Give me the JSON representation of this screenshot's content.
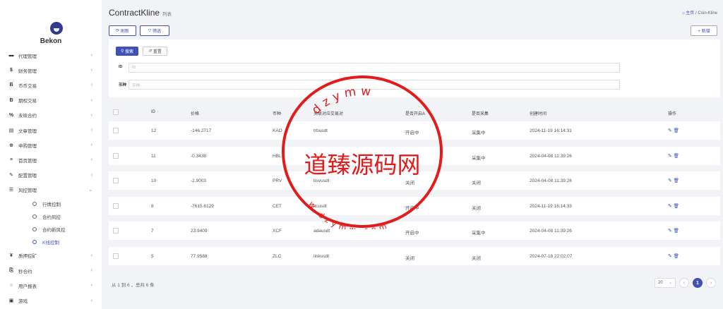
{
  "brand": {
    "name": "Bekon"
  },
  "sidebar": {
    "items": [
      {
        "icon": "agent-icon",
        "glyph": "▬",
        "label": "代理管理"
      },
      {
        "icon": "dollar-icon",
        "glyph": "$",
        "label": "财务管理"
      },
      {
        "icon": "bitcoin-icon",
        "glyph": "B",
        "label": "币币交易"
      },
      {
        "icon": "bitcoin-icon",
        "glyph": "B",
        "label": "期权交易"
      },
      {
        "icon": "link-icon",
        "glyph": "%",
        "label": "永续合约"
      },
      {
        "icon": "document-icon",
        "glyph": "▤",
        "label": "文章管理"
      },
      {
        "icon": "globe-icon",
        "glyph": "⊕",
        "label": "申购管理"
      },
      {
        "icon": "list-icon",
        "glyph": "≡",
        "label": "首页管理"
      },
      {
        "icon": "wrench-icon",
        "glyph": "✎",
        "label": "配置管理"
      },
      {
        "icon": "risk-icon",
        "glyph": "☰",
        "label": "风控管理"
      }
    ],
    "sub_items": [
      {
        "label": "行情控制"
      },
      {
        "label": "合约风控"
      },
      {
        "label": "合约新风控"
      },
      {
        "label": "K线控制"
      }
    ],
    "bottom_items": [
      {
        "icon": "yen-icon",
        "glyph": "¥",
        "label": "质押挖矿"
      },
      {
        "icon": "copy-icon",
        "glyph": "⎘",
        "label": "秒合约"
      },
      {
        "icon": "report-icon",
        "glyph": "○",
        "label": "用户报表"
      },
      {
        "icon": "game-icon",
        "glyph": "▣",
        "label": "游戏"
      }
    ]
  },
  "header": {
    "title": "ContractKline",
    "subtitle": "列表",
    "crumb_home": "主页",
    "crumb_sep": "/",
    "crumb_current": "Coin-Kline"
  },
  "toolbar": {
    "refresh": "刷新",
    "filter": "筛选",
    "add": "+ 新增"
  },
  "search": {
    "search_btn": "搜索",
    "reset_btn": "重置",
    "id_label": "ID",
    "id_placeholder": "ID",
    "coin_label": "币种",
    "coin_placeholder": "币种"
  },
  "table": {
    "headers": [
      "ID",
      "价格",
      "币种",
      "关联对应交易对",
      "是否开启A",
      "是否采集",
      "创建时间",
      "操作"
    ],
    "id_sort": "↑",
    "rows": [
      {
        "id": "12",
        "price": "-146.2717",
        "coin": "KAO",
        "pair": "trbusdt",
        "open": "开启中",
        "collect": "采集中",
        "time": "2024-11-19 16:14:31"
      },
      {
        "id": "11",
        "price": "-0.3438",
        "coin": "HBL",
        "pair": "",
        "open": "",
        "collect": "采集中",
        "time": "2024-04-08 11:39:26"
      },
      {
        "id": "10",
        "price": "-2.9003",
        "coin": "PRV",
        "pair": "bsvusdt",
        "open": "关闭",
        "collect": "关闭",
        "time": "2024-04-08 11:39:26"
      },
      {
        "id": "8",
        "price": "-7615.6129",
        "coin": "CET",
        "pair": "ltcusdt",
        "open": "开启中",
        "collect": "关闭",
        "time": "2024-11-19 16:14:33"
      },
      {
        "id": "7",
        "price": "23.9409",
        "coin": "XCF",
        "pair": "adausdt",
        "open": "开启中",
        "collect": "采集中",
        "time": "2024-04-08 11:39:26"
      },
      {
        "id": "5",
        "price": "77.9588",
        "coin": "ZLC",
        "pair": "linkusdt",
        "open": "关闭",
        "collect": "关闭",
        "time": "2024-07-18 22:02:07"
      }
    ]
  },
  "footer": {
    "summary": "从 1 到 6 ，总共 6 条"
  },
  "pager": {
    "page_size": "20",
    "prev": "‹",
    "current": "1",
    "next": "›"
  },
  "watermark": {
    "text": "道臻源码网",
    "ring_top": "dzymw",
    "ring_bottom": "w.dzymw.com"
  },
  "colors": {
    "primary": "#3f51b5",
    "stamp": "#e21b1b"
  }
}
